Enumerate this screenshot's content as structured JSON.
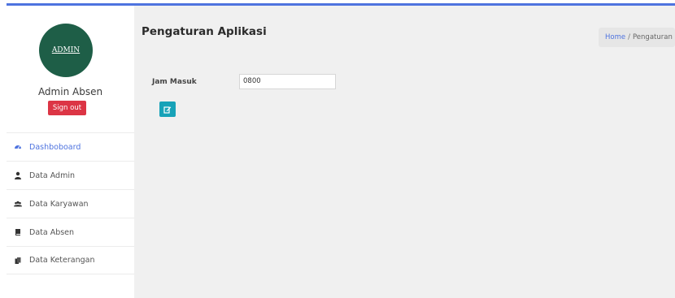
{
  "profile": {
    "avatar_text": "ADMIN",
    "name": "Admin Absen",
    "signout_label": "Sign out"
  },
  "menu": {
    "items": [
      {
        "label": "Dashboboard",
        "icon": "dashboard-icon",
        "active": true
      },
      {
        "label": "Data Admin",
        "icon": "user-icon"
      },
      {
        "label": "Data Karyawan",
        "icon": "users-icon"
      },
      {
        "label": "Data Absen",
        "icon": "book-icon"
      },
      {
        "label": "Data Keterangan",
        "icon": "copy-icon"
      }
    ]
  },
  "page": {
    "title": "Pengaturan Aplikasi"
  },
  "breadcrumb": {
    "home": "Home",
    "separator": "/",
    "current": "Pengaturan"
  },
  "form": {
    "jam_masuk_label": "Jam Masuk",
    "jam_masuk_value": "0800",
    "edit_icon": "edit-icon"
  },
  "colors": {
    "accent": "#4e73df",
    "avatar": "#1e5e47",
    "signout": "#dc3545",
    "edit_button": "#17a2b8",
    "content_bg": "#f0f0f0"
  }
}
